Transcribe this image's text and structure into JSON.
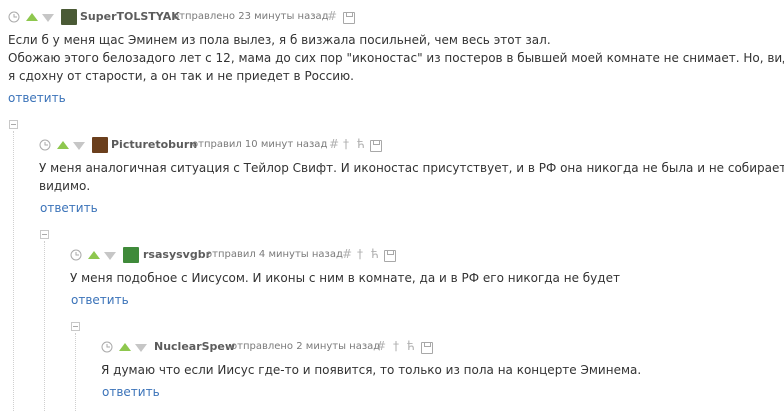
{
  "comments": [
    {
      "username": "SuperTOLSTYAK",
      "sent": "отправлено 23 минуты назад",
      "text": [
        "Если б у меня щас Эминем из пола вылез, я б визжала посильней, чем весь этот зал.",
        "Обожаю этого белозадого лет с 12, мама до сих пор \"иконостас\" из постеров в бывшей моей комнате не снимает. Но, видимо,",
        "я сдохну от старости, а он так и не приедет в Россию."
      ],
      "reply": "ответить",
      "avatar_color": "#4a5a35"
    },
    {
      "username": "Picturetoburn",
      "sent": "отправил 10 минут назад",
      "text": [
        "У меня аналогичная ситуация с Тейлор Свифт. И иконостас присутствует, и в РФ она никогда не была и не собирается",
        "видимо."
      ],
      "reply": "ответить",
      "avatar_color": "#6b3f1d"
    },
    {
      "username": "rsasysvgbr",
      "sent": "отправил 4 минуты назад",
      "text": [
        "У меня подобное с Иисусом. И иконы с ним в комнате, да и в РФ его никогда не будет"
      ],
      "reply": "ответить",
      "avatar_color": "#3f8a3a"
    },
    {
      "username": "NuclearSpew",
      "sent": "отправлено 2 минуты назад",
      "text": [
        "Я думаю что если Иисус где-то и появится, то только из пола на концерте Эминема."
      ],
      "reply": "ответить",
      "avatar_color": ""
    }
  ],
  "icons": {
    "time": "clock-icon",
    "upvote": "upvote-icon",
    "downvote": "downvote-icon",
    "link": "#",
    "parent": "†",
    "thread": "ћ",
    "save": "save-icon"
  }
}
